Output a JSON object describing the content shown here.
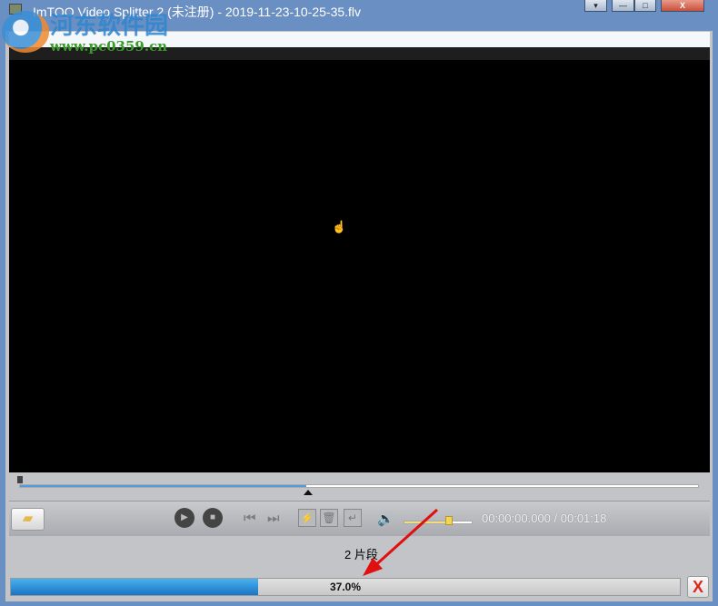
{
  "window": {
    "title": "ImTOO Video Splitter 2 (未注册) - 2019-11-23-10-25-35.flv",
    "menu_icon": "▾",
    "minimize_icon": "—",
    "maximize_icon": "□",
    "close_icon": "X"
  },
  "watermark": {
    "name": "河东软件园",
    "url": "www.pc0359.cn"
  },
  "player": {
    "position_fraction": 0.422
  },
  "toolbar": {
    "open_icon": "folder-icon",
    "play_icon": "▶",
    "stop_icon": "■",
    "prev_icon": "⏮",
    "next_icon": "⏭",
    "split_icon": "⚡",
    "delete_icon": "🗑",
    "return_icon": "↵",
    "volume_icon": "🔊",
    "volume_fraction": 0.66,
    "time": "00:00:00.000 / 00:01:18"
  },
  "segments_label": "2 片段",
  "progress": {
    "percent": 37.0,
    "label": "37.0%",
    "cancel_icon": "X"
  },
  "colors": {
    "accent": "#1a74c4",
    "cancel": "#e0261a",
    "arrow": "#e01010"
  }
}
